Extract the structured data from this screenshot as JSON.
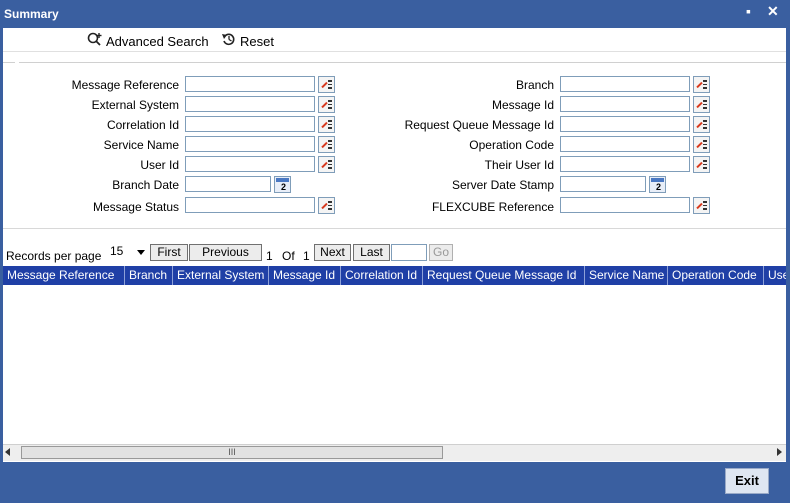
{
  "window": {
    "title": "Summary",
    "minimize_glyph": "▪",
    "close_glyph": "✕"
  },
  "toolbar": {
    "advanced_search": {
      "label": "Advanced Search",
      "icon": "advanced-search-icon"
    },
    "reset": {
      "label": "Reset",
      "icon": "reset-icon"
    }
  },
  "form": {
    "left": [
      {
        "label": "Message Reference",
        "value": ""
      },
      {
        "label": "External System",
        "value": ""
      },
      {
        "label": "Correlation Id",
        "value": ""
      },
      {
        "label": "Service Name",
        "value": ""
      },
      {
        "label": "User Id",
        "value": ""
      },
      {
        "label": "Branch Date",
        "value": ""
      },
      {
        "label": "Message Status",
        "value": ""
      }
    ],
    "right": [
      {
        "label": "Branch",
        "value": ""
      },
      {
        "label": "Message Id",
        "value": ""
      },
      {
        "label": "Request Queue Message Id",
        "value": ""
      },
      {
        "label": "Operation Code",
        "value": ""
      },
      {
        "label": "Their User Id",
        "value": ""
      },
      {
        "label": "Server Date Stamp",
        "value": ""
      },
      {
        "label": "FLEXCUBE Reference",
        "value": ""
      }
    ]
  },
  "pager": {
    "records_label": "Records per page",
    "per_page": "15",
    "first": "First",
    "previous": "Previous",
    "current_page": "1",
    "of_label": "Of",
    "total_pages": "1",
    "next": "Next",
    "last": "Last",
    "go": "Go"
  },
  "grid": {
    "columns": [
      "Message Reference",
      "Branch",
      "External System",
      "Message Id",
      "Correlation Id",
      "Request Queue Message Id",
      "Service Name",
      "Operation Code",
      "User Id"
    ]
  },
  "scrollbar": {
    "thumb_grip": "III"
  },
  "footer": {
    "exit": "Exit"
  },
  "colors": {
    "frame": "#3a5fa0",
    "grid_header": "#1f3fa6"
  }
}
